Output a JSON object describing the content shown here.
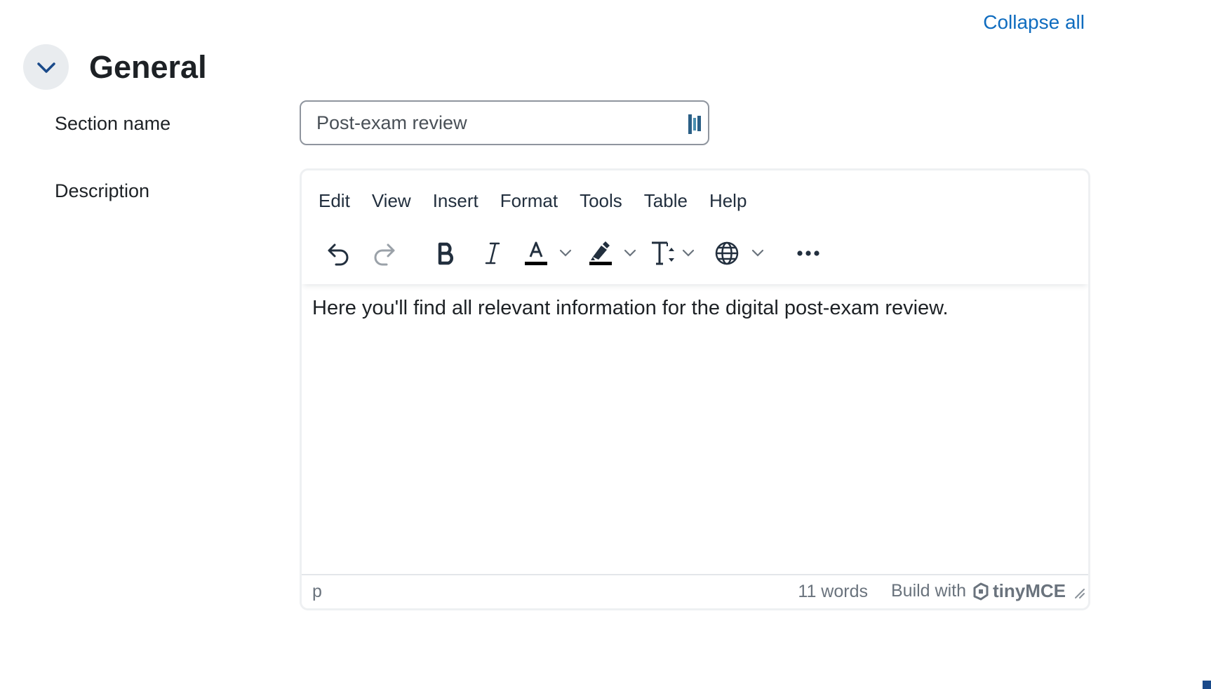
{
  "header": {
    "collapse_all_label": "Collapse all",
    "accent_color": "#0f6cbf"
  },
  "section": {
    "title": "General"
  },
  "form": {
    "section_name": {
      "label": "Section name",
      "value": "Post-exam review"
    },
    "description": {
      "label": "Description"
    }
  },
  "editor": {
    "menu": [
      "Edit",
      "View",
      "Insert",
      "Format",
      "Tools",
      "Table",
      "Help"
    ],
    "toolbar_icons": [
      "undo-icon",
      "redo-icon",
      "bold-icon",
      "italic-icon",
      "text-color-icon",
      "highlight-color-icon",
      "font-size-icon",
      "language-icon",
      "more-icon"
    ],
    "content_text": "Here you'll find all relevant information for the digital post-exam review.",
    "status": {
      "path": "p",
      "word_count": "11 words",
      "brand_prefix": "Build with",
      "brand_name": "tinyMCE"
    }
  }
}
